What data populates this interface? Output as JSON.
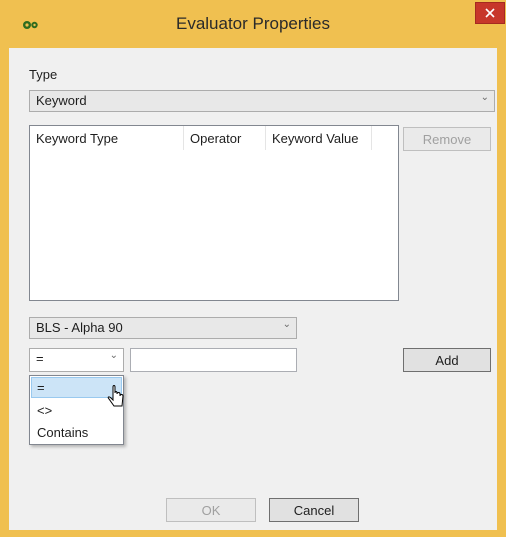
{
  "window": {
    "title": "Evaluator Properties",
    "accent": "#f0c050",
    "close_color": "#c7372a"
  },
  "type_section": {
    "label": "Type",
    "selected": "Keyword"
  },
  "keyword_list": {
    "columns": [
      "Keyword Type",
      "Operator",
      "Keyword Value"
    ],
    "rows": []
  },
  "remove_button": {
    "label": "Remove",
    "enabled": false
  },
  "keyword_type_combo": {
    "selected": "BLS - Alpha 90"
  },
  "operator_combo": {
    "selected": "=",
    "options": [
      "=",
      "<>",
      "Contains"
    ],
    "highlighted_index": 0
  },
  "value_input": {
    "value": ""
  },
  "add_button": {
    "label": "Add"
  },
  "footer": {
    "ok_label": "OK",
    "ok_enabled": false,
    "cancel_label": "Cancel"
  },
  "icons": {
    "app": "gear-icon",
    "close": "close-icon",
    "chevron": "chevron-down-icon",
    "pointer": "mouse-pointer-icon"
  }
}
